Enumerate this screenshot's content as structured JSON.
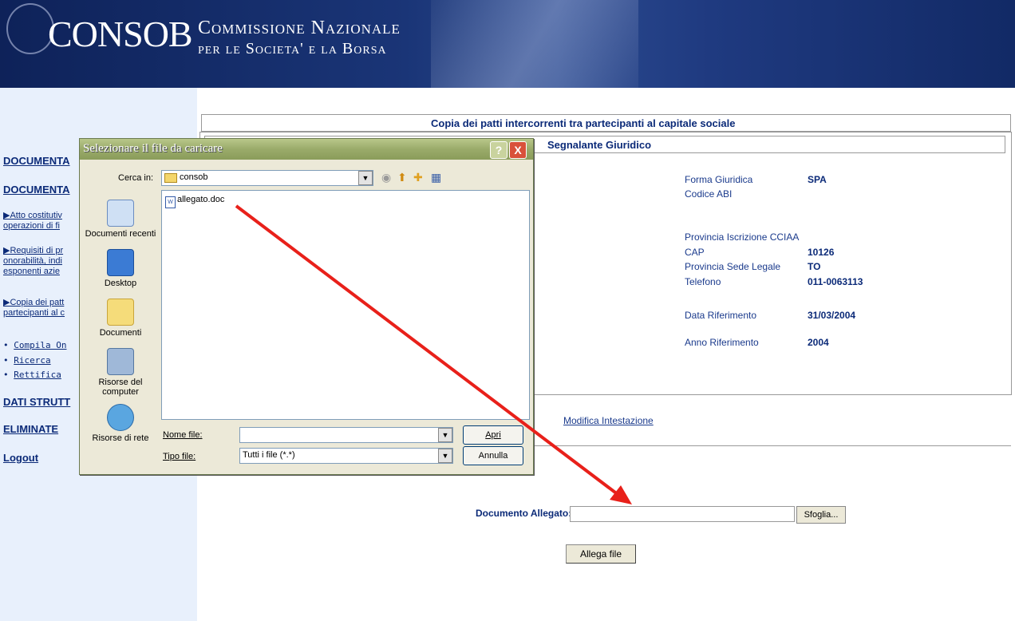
{
  "banner": {
    "brand": "CONSOB",
    "subtitle_line1": "Commissione Nazionale",
    "subtitle_line2": "per le Societa' e la Borsa"
  },
  "sidebar": {
    "head1": "DOCUMENTA",
    "head2": "DOCUMENTA",
    "link1_a": "Atto costitutiv",
    "link1_b": "operazioni di fi",
    "link2_a": "Requisiti di pr",
    "link2_b": "onorabilità, indi",
    "link2_c": "esponenti azie",
    "link3_a": "Copia dei patt",
    "link3_b": "partecipanti al c",
    "bullet1": "Compila On",
    "bullet2": "Ricerca",
    "bullet3": "Rettifica",
    "head3": "DATI STRUTT",
    "head4": "ELIMINATE",
    "logout": "Logout"
  },
  "main": {
    "title": "Copia dei patti intercorrenti tra partecipanti al capitale sociale",
    "section": "Segnalante Giuridico",
    "fields": {
      "forma_label": "Forma Giuridica",
      "forma_value": "SPA",
      "abi_label": "Codice ABI",
      "cciaa_label": "Provincia Iscrizione CCIAA",
      "cap_label": "CAP",
      "cap_value": "10126",
      "prov_label": "Provincia Sede Legale",
      "prov_value": "TO",
      "tel_label": "Telefono",
      "tel_value": "011-0063113",
      "data_label": "Data Riferimento",
      "data_value": "31/03/2004",
      "anno_label": "Anno Riferimento",
      "anno_value": "2004"
    },
    "modifica": "Modifica Intestazione",
    "doc_label": "Documento Allegato:",
    "doc_value": "",
    "sfoglia": "Sfoglia...",
    "allega": "Allega file"
  },
  "dialog": {
    "title": "Selezionare il file da caricare",
    "help": "?",
    "close": "X",
    "cerca_label": "Cerca in:",
    "cerca_value": "consob",
    "places": [
      "Documenti recenti",
      "Desktop",
      "Documenti",
      "Risorse del computer",
      "Risorse di rete"
    ],
    "file": "allegato.doc",
    "nome_label": "Nome file:",
    "nome_value": "",
    "tipo_label": "Tipo file:",
    "tipo_value": "Tutti i file (*.*)",
    "apri": "Apri",
    "annulla": "Annulla"
  },
  "colors": {
    "arrow": "#e8201a",
    "sidebar_bg": "#e8f0fc",
    "link": "#0b2a78",
    "dialog_title": "#9aab6a"
  }
}
